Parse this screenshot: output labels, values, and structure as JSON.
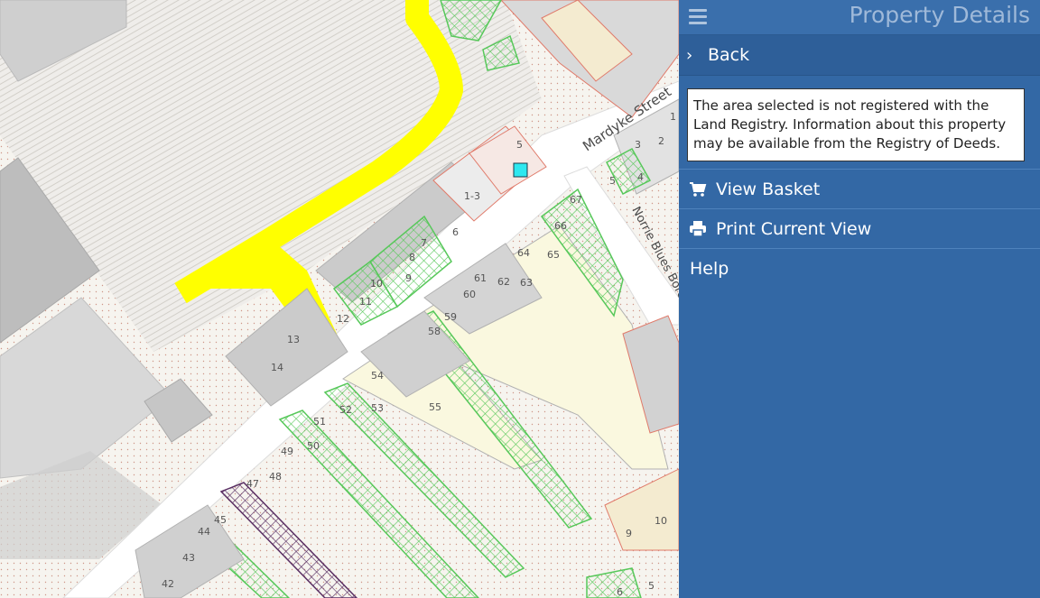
{
  "panel": {
    "title": "Property Details",
    "back_label": "Back",
    "notice": "The area selected is not registered with the Land Registry. Information about this property may be available from the Registry of Deeds.",
    "menu": [
      {
        "label": "View Basket",
        "icon": "shopping-cart-icon"
      },
      {
        "label": "Print Current View",
        "icon": "printer-icon"
      }
    ],
    "help_label": "Help"
  },
  "map": {
    "streets": [
      "Mardyke Street",
      "Norrie Blues Boreen"
    ],
    "parcel_numbers": [
      "5",
      "1-3",
      "6",
      "7",
      "8",
      "9",
      "10",
      "11",
      "12",
      "13",
      "14",
      "3",
      "2",
      "1",
      "5",
      "4",
      "66",
      "67",
      "64",
      "65",
      "61",
      "62",
      "63",
      "60",
      "59",
      "58",
      "54",
      "53",
      "55",
      "52",
      "51",
      "50",
      "49",
      "48",
      "47",
      "45",
      "44",
      "43",
      "42",
      "10",
      "9",
      "6",
      "5"
    ],
    "colors": {
      "registered_hatch": "#57c85a",
      "highlight_route": "#ffff00",
      "selected_marker": "#2ee8f0",
      "restricted_hatch": "#5a2f63",
      "panel": "#3368a5"
    }
  }
}
